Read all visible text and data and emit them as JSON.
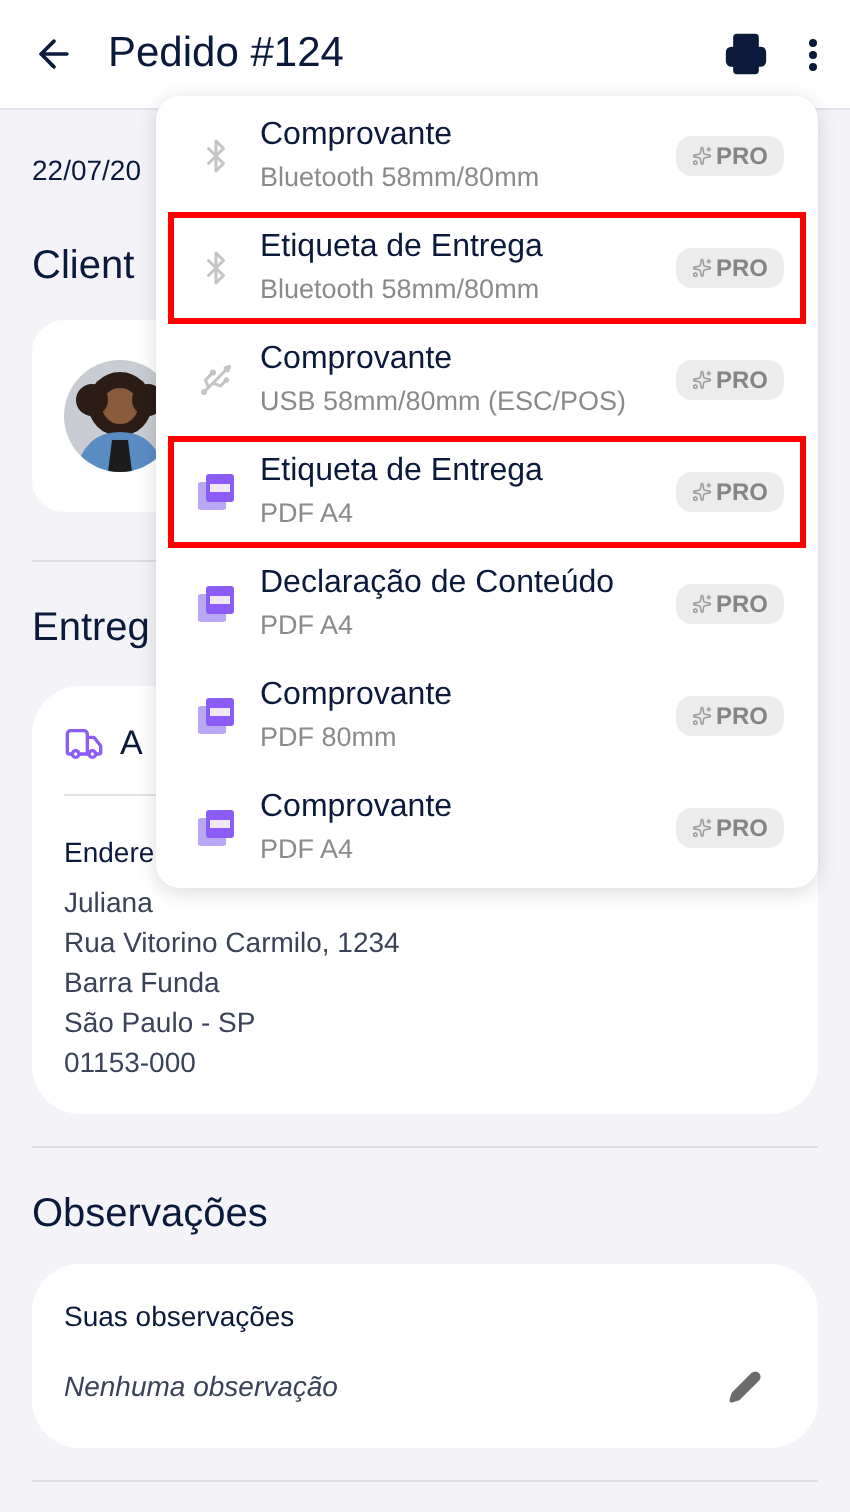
{
  "header": {
    "title": "Pedido #124"
  },
  "date": "22/07/20",
  "client": {
    "heading": "Client"
  },
  "delivery": {
    "heading": "Entreg",
    "card_title": "A",
    "address_label": "Endere",
    "address_lines": [
      "Juliana ",
      "Rua Vitorino Carmilo, 1234",
      "Barra Funda",
      "São Paulo - SP",
      "01153-000"
    ]
  },
  "notes": {
    "heading": "Observações",
    "label": "Suas observações",
    "value": "Nenhuma observação"
  },
  "menu": {
    "items": [
      {
        "kind": "bluetooth",
        "title": "Comprovante",
        "subtitle": "Bluetooth 58mm/80mm",
        "badge": "PRO",
        "highlighted": false
      },
      {
        "kind": "bluetooth",
        "title": "Etiqueta de Entrega",
        "subtitle": "Bluetooth 58mm/80mm",
        "badge": "PRO",
        "highlighted": true
      },
      {
        "kind": "usb",
        "title": "Comprovante",
        "subtitle": "USB 58mm/80mm (ESC/POS)",
        "badge": "PRO",
        "highlighted": false
      },
      {
        "kind": "pdf",
        "title": "Etiqueta de Entrega",
        "subtitle": "PDF A4",
        "badge": "PRO",
        "highlighted": true
      },
      {
        "kind": "pdf",
        "title": "Declaração de Conteúdo",
        "subtitle": "PDF A4",
        "badge": "PRO",
        "highlighted": false
      },
      {
        "kind": "pdf",
        "title": "Comprovante",
        "subtitle": "PDF 80mm",
        "badge": "PRO",
        "highlighted": false
      },
      {
        "kind": "pdf",
        "title": "Comprovante",
        "subtitle": "PDF A4",
        "badge": "PRO",
        "highlighted": false
      }
    ]
  }
}
